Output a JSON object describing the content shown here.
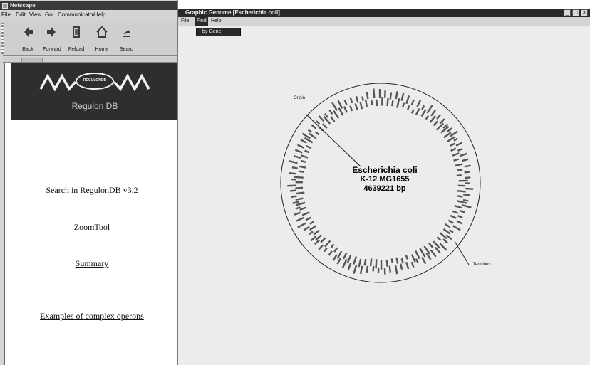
{
  "netscape": {
    "window_title": "Netscape",
    "menu": [
      "File",
      "Edit",
      "View",
      "Go",
      "Communicator",
      "Help"
    ],
    "toolbar": [
      {
        "label": "Back",
        "icon": "back-arrow-icon"
      },
      {
        "label": "Forward",
        "icon": "forward-arrow-icon"
      },
      {
        "label": "Reload",
        "icon": "reload-icon"
      },
      {
        "label": "Home",
        "icon": "home-icon"
      },
      {
        "label": "Searc",
        "icon": "search-icon"
      }
    ],
    "banner": {
      "logo_text": "REGULONDB",
      "brand": "Regulon DB"
    },
    "links": [
      "Search in RegulonDB v3.2",
      "ZoomTool",
      "Summary",
      "Examples of  complex operons"
    ]
  },
  "genome_window": {
    "title": "Graphic Genome  [Escherichia coli]",
    "menu": [
      "File",
      "Find",
      "Help"
    ],
    "active_menu": "Find",
    "dropdown_items": [
      "by Gene"
    ],
    "controls": [
      "_",
      "□",
      "×"
    ],
    "genome": {
      "organism": "Escherichia coli",
      "strain": "K-12  MG1655",
      "size": "4639221 bp",
      "markers": [
        "Origin",
        "Terminus"
      ]
    }
  },
  "colors": {
    "titlebar": "#2a2a2a",
    "banner": "#2e2e2e",
    "window_bg": "#d4d4d4",
    "canvas_bg": "#ececec",
    "gene_bars": "#555555"
  }
}
